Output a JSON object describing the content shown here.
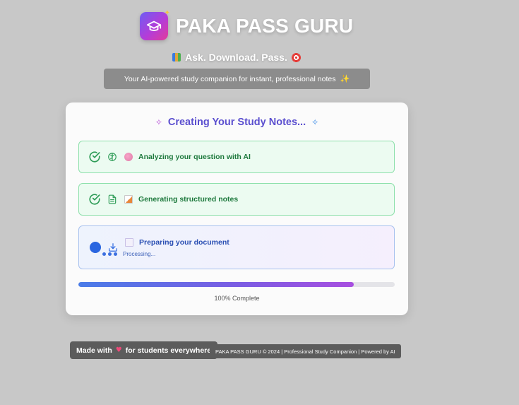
{
  "header": {
    "app_title": "PAKA PASS GURU",
    "logo_icon": "graduation-cap-icon",
    "tagline": "Ask. Download. Pass.",
    "subtitle": "Your AI-powered study companion for instant, professional notes"
  },
  "card": {
    "title": "Creating Your Study Notes...",
    "steps": [
      {
        "status": "done",
        "icon": "brain-icon",
        "label": "Analyzing your question with AI"
      },
      {
        "status": "done",
        "icon": "document-icon",
        "label": "Generating structured notes"
      },
      {
        "status": "active",
        "icon": "download-icon",
        "label": "Preparing your document",
        "sub": "Processing..."
      }
    ],
    "progress": {
      "percent": 87,
      "label": "100% Complete"
    }
  },
  "footer": {
    "made_pre": "Made with",
    "made_post": "for students everywhere",
    "copyright": "PAKA PASS GURU © 2024 | Professional Study Companion | Powered by AI"
  },
  "colors": {
    "accent": "#5b4fcf",
    "success": "#1f7a3e",
    "active": "#2a66e0",
    "background": "#c8c8c8"
  }
}
